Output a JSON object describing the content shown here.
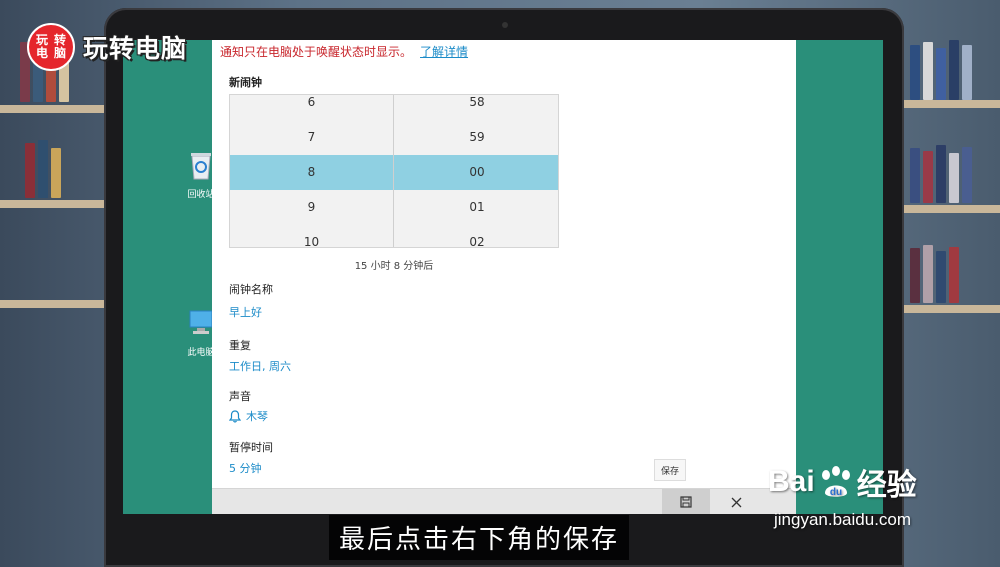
{
  "logo": {
    "badge_chars": [
      "玩",
      "转",
      "电",
      "脑"
    ],
    "text": "玩转电脑"
  },
  "desktop": {
    "recycle_bin_label": "回收站",
    "this_pc_label": "此电脑"
  },
  "alarm_app": {
    "notice": "通知只在电脑处于唤醒状态时显示。",
    "notice_link": "了解详情",
    "section_title": "新闹钟",
    "hours": [
      "6",
      "7",
      "8",
      "9",
      "10"
    ],
    "minutes": [
      "58",
      "59",
      "00",
      "01",
      "02"
    ],
    "selected_index": 2,
    "countdown": "15 小时 8 分钟后",
    "name_label": "闹钟名称",
    "name_value": "早上好",
    "repeat_label": "重复",
    "repeat_value": "工作日, 周六",
    "sound_label": "声音",
    "sound_value": "木琴",
    "snooze_label": "暂停时间",
    "snooze_value": "5 分钟",
    "save_label": "保存",
    "cmd_save_icon": "save-icon",
    "cmd_close_icon": "close-icon"
  },
  "caption": "最后点击右下角的保存",
  "watermark": {
    "brand_left": "Bai",
    "brand_right": "经验",
    "url": "jingyan.baidu.com"
  },
  "colors": {
    "desktop_bg": "#2a8f7a",
    "accent_blue": "#1b8bc8",
    "selected_row": "#8fd0e2",
    "notice_red": "#c8262c",
    "logo_red": "#e5262c"
  }
}
